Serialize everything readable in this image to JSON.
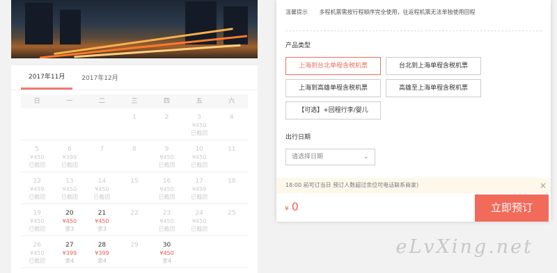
{
  "calendar": {
    "tabs": [
      "2017年11月",
      "2017年12月"
    ],
    "weekdays": [
      "日",
      "一",
      "二",
      "三",
      "四",
      "五",
      "六"
    ],
    "days": [
      {
        "d": "",
        "p": "",
        "s": "",
        "a": false
      },
      {
        "d": "",
        "p": "",
        "s": "",
        "a": false
      },
      {
        "d": "",
        "p": "",
        "s": "",
        "a": false
      },
      {
        "d": "1",
        "p": "",
        "s": "",
        "a": false
      },
      {
        "d": "2",
        "p": "",
        "s": "",
        "a": false
      },
      {
        "d": "3",
        "p": "¥450",
        "s": "已截团",
        "a": false
      },
      {
        "d": "4",
        "p": "",
        "s": "",
        "a": false
      },
      {
        "d": "5",
        "p": "¥450",
        "s": "已截团",
        "a": false
      },
      {
        "d": "6",
        "p": "¥399",
        "s": "已截团",
        "a": false
      },
      {
        "d": "7",
        "p": "",
        "s": "",
        "a": false
      },
      {
        "d": "8",
        "p": "",
        "s": "",
        "a": false
      },
      {
        "d": "9",
        "p": "¥450",
        "s": "已截团",
        "a": false
      },
      {
        "d": "10",
        "p": "¥450",
        "s": "已截团",
        "a": false
      },
      {
        "d": "11",
        "p": "",
        "s": "",
        "a": false
      },
      {
        "d": "12",
        "p": "¥499",
        "s": "已截团",
        "a": false
      },
      {
        "d": "13",
        "p": "¥450",
        "s": "已截团",
        "a": false
      },
      {
        "d": "14",
        "p": "¥450",
        "s": "已截团",
        "a": false
      },
      {
        "d": "15",
        "p": "",
        "s": "",
        "a": false
      },
      {
        "d": "16",
        "p": "¥450",
        "s": "已截团",
        "a": false
      },
      {
        "d": "17",
        "p": "¥499",
        "s": "已截团",
        "a": false
      },
      {
        "d": "18",
        "p": "",
        "s": "",
        "a": false
      },
      {
        "d": "19",
        "p": "¥450",
        "s": "已截团",
        "a": false
      },
      {
        "d": "20",
        "p": "¥450",
        "s": "余3",
        "a": true
      },
      {
        "d": "21",
        "p": "¥450",
        "s": "余3",
        "a": true
      },
      {
        "d": "22",
        "p": "",
        "s": "",
        "a": false
      },
      {
        "d": "23",
        "p": "¥450",
        "s": "已截团",
        "a": false
      },
      {
        "d": "24",
        "p": "¥450",
        "s": "已截团",
        "a": false
      },
      {
        "d": "25",
        "p": "",
        "s": "",
        "a": false
      },
      {
        "d": "26",
        "p": "¥450",
        "s": "已截团",
        "a": false
      },
      {
        "d": "27",
        "p": "¥399",
        "s": "余4",
        "a": true
      },
      {
        "d": "28",
        "p": "¥399",
        "s": "余4",
        "a": true
      },
      {
        "d": "29",
        "p": "",
        "s": "",
        "a": false
      },
      {
        "d": "30",
        "p": "¥450",
        "s": "余4",
        "a": true
      },
      {
        "d": "",
        "p": "",
        "s": "",
        "a": false
      },
      {
        "d": "",
        "p": "",
        "s": "",
        "a": false
      }
    ]
  },
  "panel": {
    "tip_label": "温馨提示",
    "tip_text": "多程机票需按行程顺序完全使用，往返程机票无法单独使用回程",
    "product_type_label": "产品类型",
    "options": [
      "上海到台北单程含税机票",
      "台北到上海单程含税机票",
      "上海到高雄单程含税机票",
      "高雄至上海单程含税机票",
      "【可选】+回程行李/婴儿"
    ],
    "date_label": "出行日期",
    "date_placeholder": "请选择日期",
    "notice": "18:00 前可订当日 预订人数超过余位可电话联系商家)",
    "currency": "¥",
    "total": "0",
    "book_label": "立即预订"
  },
  "watermark": "eLvXing.net",
  "colors": {
    "accent": "#f26a5a",
    "price": "#e85c4f"
  }
}
